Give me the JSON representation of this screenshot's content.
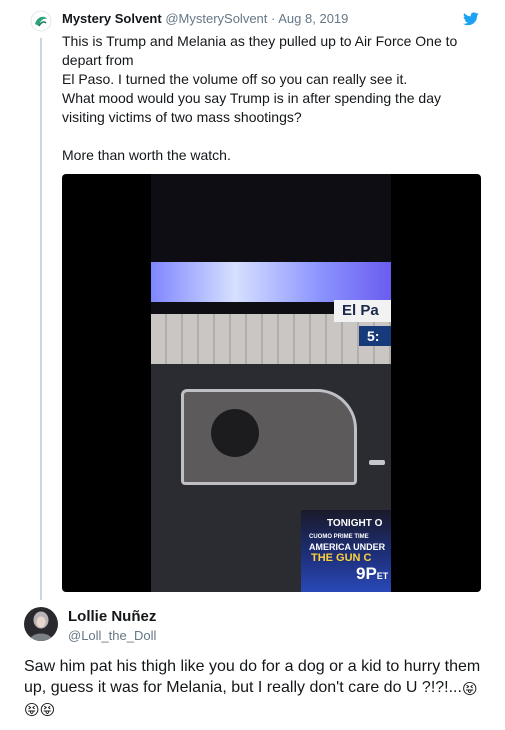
{
  "quoted_tweet": {
    "author_name": "Mystery Solvent",
    "author_handle": "@MysterySolvent",
    "separator": "·",
    "date": "Aug 8, 2019",
    "text_lines": [
      "This is Trump and Melania as they pulled up to Air Force One to depart from",
      "El Paso. I turned the volume off so you can really see it.",
      "What mood would you say Trump is in after spending the day visiting victims of two mass shootings?",
      "More than worth the watch."
    ],
    "video": {
      "location_label": "El Pa",
      "time_label": "5:",
      "promo_line1": "TONIGHT O",
      "promo_line2": "CUOMO PRIME TIME",
      "promo_line3": "AMERICA UNDER",
      "promo_line4": "THE GUN C",
      "promo_time": "9P",
      "promo_timezone": "ET"
    }
  },
  "reply": {
    "author_name": "Lollie Nuñez",
    "author_handle": "@Loll_the_Doll",
    "text": "Saw him pat his thigh like you do for a dog or a kid to hurry them up, guess it was for Melania, but I really don't care do U ?!?!...",
    "emojis": [
      "😝",
      "😝",
      "😝"
    ]
  },
  "icons": {
    "platform_icon": "twitter-bird-icon",
    "emoji_name": "squinting-face-with-tongue"
  },
  "colors": {
    "accent_blue": "#1da1f2",
    "text_primary": "#14171a",
    "text_secondary": "#657786",
    "thread_line": "#ccd6dd",
    "emoji_pink": "#f26b8a"
  }
}
